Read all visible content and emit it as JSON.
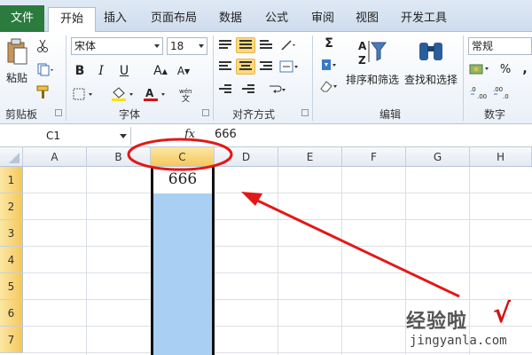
{
  "tabs": [
    "文件",
    "开始",
    "插入",
    "页面布局",
    "数据",
    "公式",
    "审阅",
    "视图",
    "开发工具"
  ],
  "clipboard": {
    "paste_label": "粘贴",
    "group_label": "剪贴板"
  },
  "font": {
    "font_name": "宋体",
    "font_size": "18",
    "group_label": "字体"
  },
  "alignment": {
    "group_label": "对齐方式"
  },
  "editing": {
    "sort_filter_label": "排序和筛选",
    "find_select_label": "查找和选择",
    "group_label": "编辑",
    "sum_symbol": "Σ"
  },
  "number": {
    "format": "常规",
    "percent": "%",
    "comma": ",",
    "group_label": "数字"
  },
  "formula_bar": {
    "name_box": "C1",
    "fx_label": "fx",
    "value": "666"
  },
  "columns": [
    "A",
    "B",
    "C",
    "D",
    "E",
    "F",
    "G",
    "H"
  ],
  "rows": [
    "1",
    "2",
    "3",
    "4",
    "5",
    "6",
    "7"
  ],
  "cells": {
    "C1": "666"
  },
  "selected_column": "C",
  "annotation_color": "#e21818",
  "watermark": {
    "cn": "经验啦",
    "en": "jingyanla.com",
    "check": "√"
  }
}
